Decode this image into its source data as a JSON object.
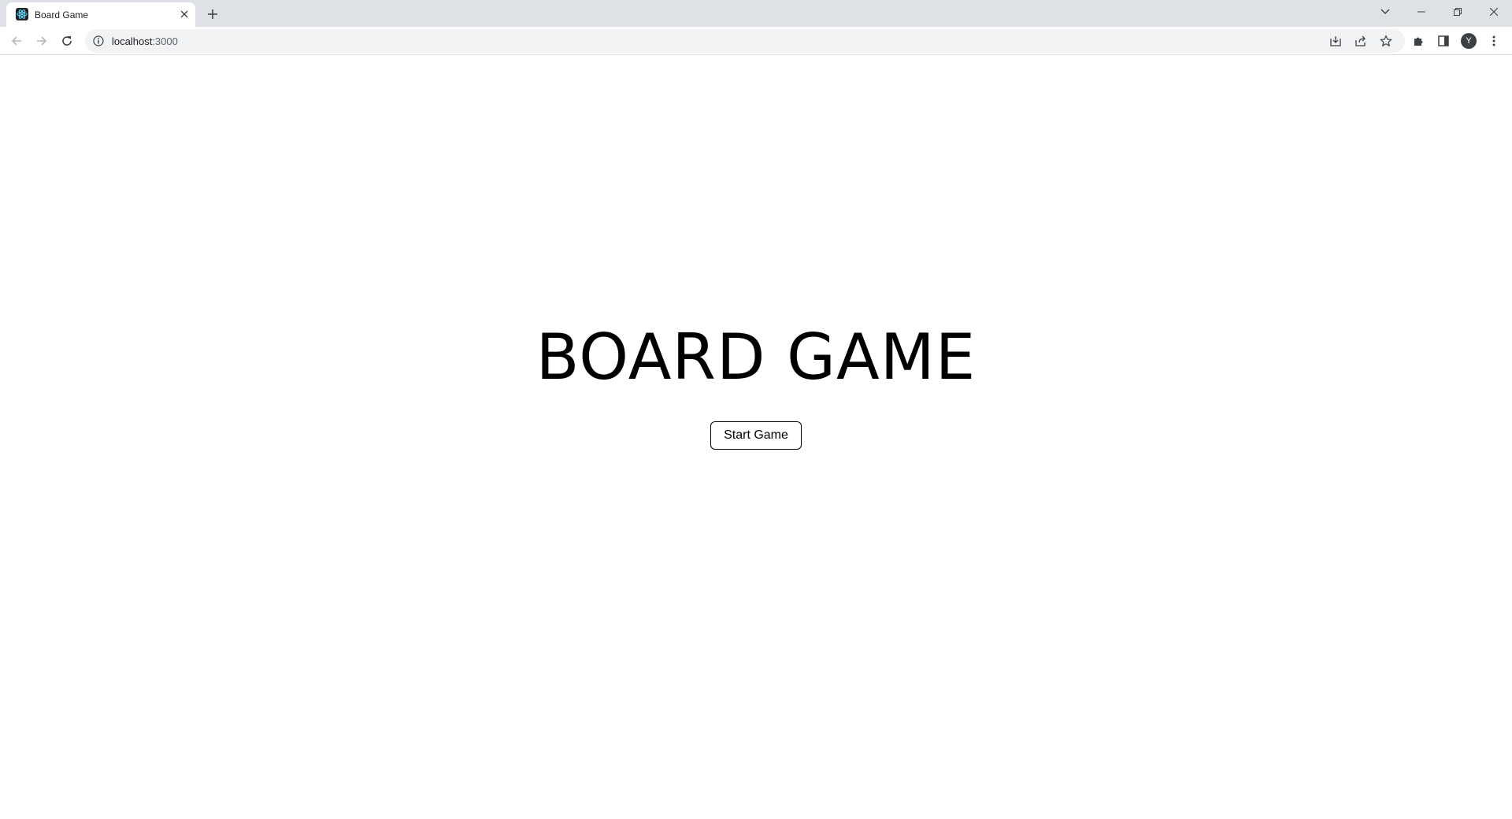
{
  "browser": {
    "tab": {
      "title": "Board Game",
      "favicon": "react-logo-icon"
    },
    "address_bar": {
      "host": "localhost",
      "port": ":3000"
    },
    "profile_initial": "Y",
    "colors": {
      "tabstrip": "#dee1e6",
      "omnibox": "#f1f3f4"
    }
  },
  "page": {
    "title": "BOARD GAME",
    "start_button_label": "Start Game"
  }
}
